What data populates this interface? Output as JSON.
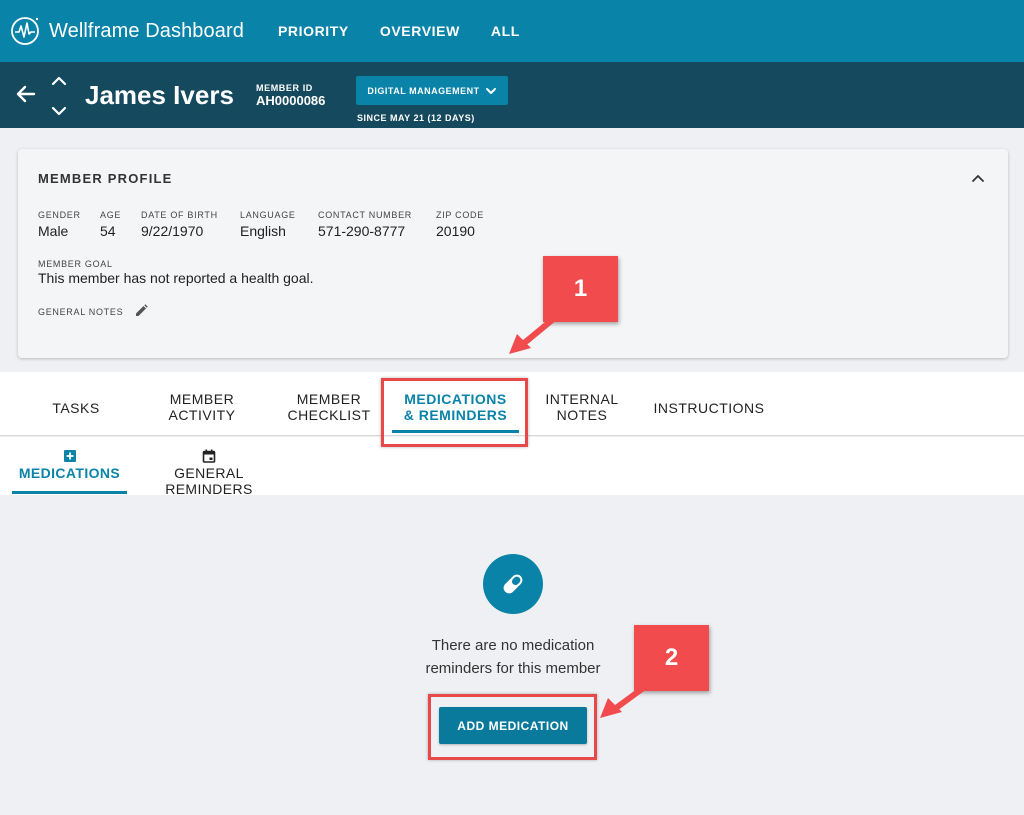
{
  "app": {
    "title": "Wellframe Dashboard"
  },
  "nav": {
    "items": [
      "PRIORITY",
      "OVERVIEW",
      "ALL"
    ]
  },
  "member": {
    "name": "James Ivers",
    "id_label": "MEMBER ID",
    "id_value": "AH0000086",
    "program_button": "DIGITAL MANAGEMENT",
    "since": "SINCE MAY 21 (12 DAYS)"
  },
  "profile": {
    "title": "MEMBER PROFILE",
    "fields": [
      {
        "label": "GENDER",
        "value": "Male"
      },
      {
        "label": "AGE",
        "value": "54"
      },
      {
        "label": "DATE OF BIRTH",
        "value": "9/22/1970"
      },
      {
        "label": "LANGUAGE",
        "value": "English"
      },
      {
        "label": "CONTACT NUMBER",
        "value": "571-290-8777"
      },
      {
        "label": "ZIP CODE",
        "value": "20190"
      }
    ],
    "goal_label": "MEMBER GOAL",
    "goal_value": "This member has not reported a health goal.",
    "notes_label": "GENERAL NOTES"
  },
  "tabs": [
    {
      "line1": "TASKS",
      "line2": ""
    },
    {
      "line1": "MEMBER",
      "line2": "ACTIVITY"
    },
    {
      "line1": "MEMBER",
      "line2": "CHECKLIST"
    },
    {
      "line1": "MEDICATIONS",
      "line2": "& REMINDERS"
    },
    {
      "line1": "INTERNAL",
      "line2": "NOTES"
    },
    {
      "line1": "INSTRUCTIONS",
      "line2": ""
    }
  ],
  "subtabs": [
    "MEDICATIONS",
    "GENERAL REMINDERS"
  ],
  "empty_state": {
    "line1": "There are no medication",
    "line2": "reminders for this member",
    "button": "ADD MEDICATION"
  },
  "callouts": [
    "1",
    "2"
  ],
  "colors": {
    "primary": "#0a83a8",
    "header_dark": "#15495d",
    "annotation": "#e7484a"
  }
}
